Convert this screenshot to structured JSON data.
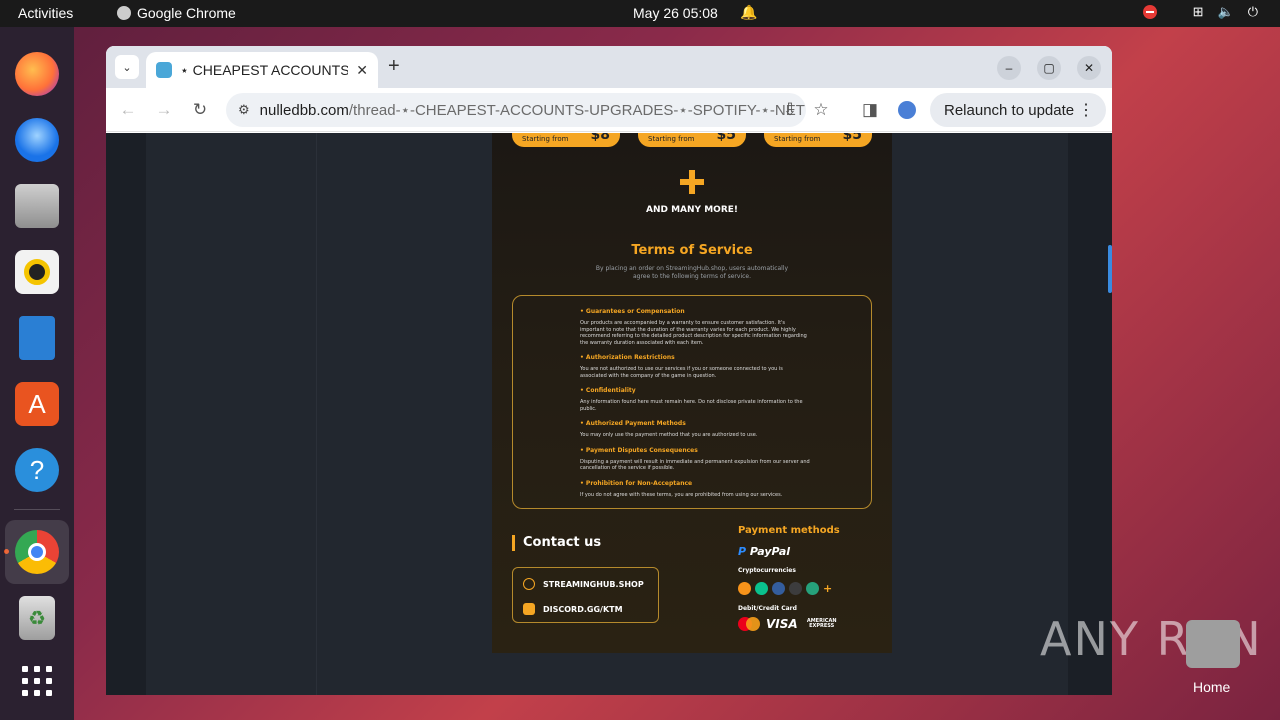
{
  "topbar": {
    "activities": "Activities",
    "app_name": "Google Chrome",
    "datetime": "May 26  05:08"
  },
  "dock": {
    "items": [
      {
        "name": "firefox",
        "color": "#ff7139"
      },
      {
        "name": "thunderbird",
        "color": "#1a73e8"
      },
      {
        "name": "files",
        "color": "#a0a0a0"
      },
      {
        "name": "rhythmbox",
        "color": "#f5c400"
      },
      {
        "name": "libreoffice-writer",
        "color": "#2a7fd4"
      },
      {
        "name": "app-center",
        "color": "#e95420"
      },
      {
        "name": "help",
        "color": "#2a8fdc"
      },
      {
        "name": "chrome",
        "color": "#34a853"
      },
      {
        "name": "trash",
        "color": "#6a9a55"
      }
    ]
  },
  "browser": {
    "tab_title": "⋆ CHEAPEST ACCOUNTS",
    "url_domain": "nulledbb.com",
    "url_path": "/thread-⋆-CHEAPEST-ACCOUNTS-UPGRADES-⋆-SPOTIFY-⋆-NETFL...",
    "relaunch_label": "Relaunch to update"
  },
  "poster": {
    "pills": [
      {
        "label": "Starting from",
        "price": "$8"
      },
      {
        "label": "Starting from",
        "price": "$5"
      },
      {
        "label": "Starting from",
        "price": "$5"
      }
    ],
    "many_more": "AND MANY MORE!",
    "tos_title": "Terms of Service",
    "tos_subtitle": "By placing an order on StreamingHub.shop, users automatically agree to the following terms of service.",
    "tos_sections": [
      {
        "heading": "• Guarantees or Compensation",
        "body": "Our products are accompanied by a warranty to ensure customer satisfaction. It's important to note that the duration of the warranty varies for each product. We highly recommend referring to the detailed product description for specific information regarding the warranty duration associated with each item."
      },
      {
        "heading": "• Authorization Restrictions",
        "body": "You are not authorized to use our services if you or someone connected to you is associated with the company of the game in question."
      },
      {
        "heading": "• Confidentiality",
        "body": "Any information found here must remain here. Do not disclose private information to the public."
      },
      {
        "heading": "• Authorized Payment Methods",
        "body": "You may only use the payment method that you are authorized to use."
      },
      {
        "heading": "• Payment Disputes Consequences",
        "body": "Disputing a payment will result in immediate and permanent expulsion from our server and cancellation of the service if possible."
      },
      {
        "heading": "• Prohibition for Non-Acceptance",
        "body": "If you do not agree with these terms, you are prohibited from using our services."
      }
    ],
    "contact_title": "Contact us",
    "contact_web": "STREAMINGHUB.SHOP",
    "contact_discord": "DISCORD.GG/KTM",
    "payment_title": "Payment methods",
    "paypal": "PayPal",
    "crypto_label": "Cryptocurrencies",
    "coins": [
      {
        "name": "bitcoin",
        "color": "#f7931a"
      },
      {
        "name": "bitcoin-cash",
        "color": "#0ac18e"
      },
      {
        "name": "litecoin",
        "color": "#345d9d"
      },
      {
        "name": "ethereum",
        "color": "#3c3c3d"
      },
      {
        "name": "tether",
        "color": "#26a17b"
      }
    ],
    "coin_more": "+",
    "card_label": "Debit/Credit Card",
    "visa": "VISA",
    "amex": "AMERICAN EXPRESS"
  },
  "desktop": {
    "watermark": "ANY RUN",
    "home_label": "Home"
  }
}
